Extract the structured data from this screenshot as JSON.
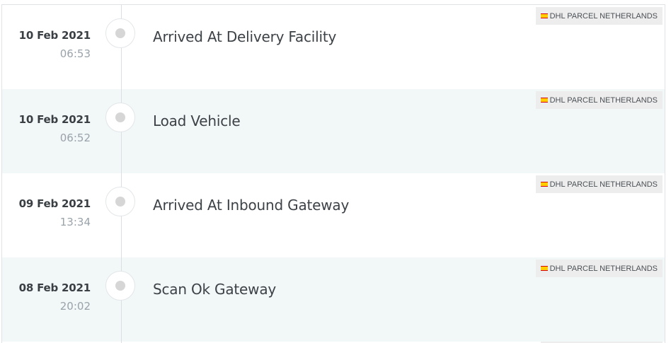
{
  "events": [
    {
      "date": "10 Feb 2021",
      "time": "06:53",
      "status": "Arrived At Delivery Facility",
      "carrier": "DHL PARCEL NETHERLANDS"
    },
    {
      "date": "10 Feb 2021",
      "time": "06:52",
      "status": "Load Vehicle",
      "carrier": "DHL PARCEL NETHERLANDS"
    },
    {
      "date": "09 Feb 2021",
      "time": "13:34",
      "status": "Arrived At Inbound Gateway",
      "carrier": "DHL PARCEL NETHERLANDS"
    },
    {
      "date": "08 Feb 2021",
      "time": "20:02",
      "status": "Scan Ok Gateway",
      "carrier": "DHL PARCEL NETHERLANDS"
    }
  ],
  "icons": {
    "timeline_node": "circle-dot-icon",
    "carrier_logo": "dhl-flag-icon"
  },
  "colors": {
    "alt_row": "#f2f7f8",
    "carrier_badge": "#ededed",
    "dhl_yellow": "#ffcc00",
    "dhl_red": "#d40511"
  }
}
